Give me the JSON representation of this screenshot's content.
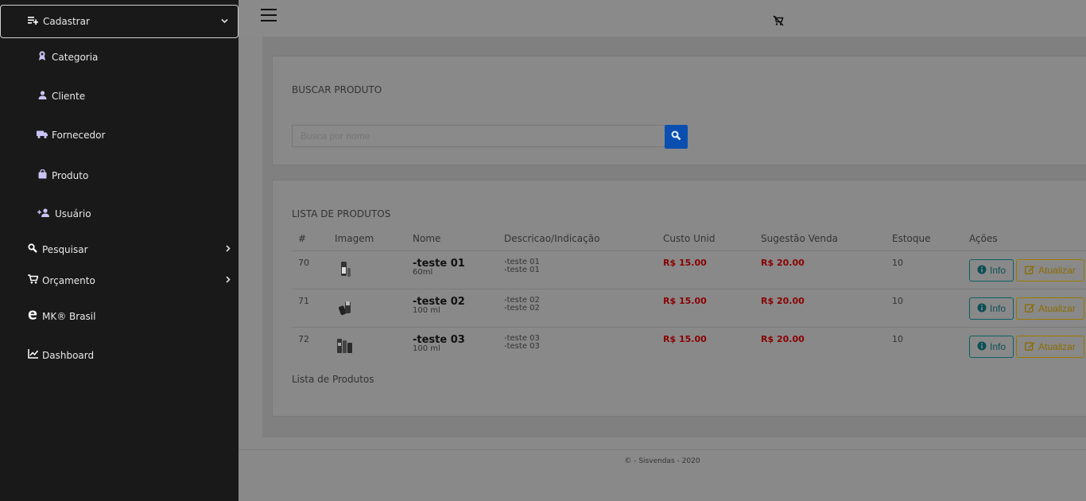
{
  "sidebar": {
    "cadastrar": {
      "label": "Cadastrar",
      "icon": "playlist-add-icon"
    },
    "sub_items": [
      {
        "label": "Categoria",
        "icon": "award-icon"
      },
      {
        "label": "Cliente",
        "icon": "user-icon"
      },
      {
        "label": "Fornecedor",
        "icon": "truck-icon"
      },
      {
        "label": "Produto",
        "icon": "bag-icon"
      },
      {
        "label": "Usuário",
        "icon": "user-plus-icon"
      }
    ],
    "items": [
      {
        "label": "Pesquisar",
        "icon": "search-icon"
      },
      {
        "label": "Orçamento",
        "icon": "cart-icon"
      },
      {
        "label": "MK® Brasil",
        "icon": "edge-icon"
      },
      {
        "label": "Dashboard",
        "icon": "chart-line-icon"
      }
    ]
  },
  "search_card": {
    "title": "BUSCAR PRODUTO",
    "placeholder": "Busca por nome"
  },
  "list_card": {
    "title": "LISTA DE PRODUTOS",
    "columns": [
      "#",
      "Imagem",
      "Nome",
      "Descricao/Indicação",
      "Custo Unid",
      "Sugestão Venda",
      "Estoque",
      "Ações"
    ],
    "rows": [
      {
        "id": "70",
        "name": "-teste 01",
        "size": "60ml",
        "desc1": "-teste 01",
        "desc2": "-teste 01",
        "cost": "R$ 15.00",
        "price": "R$ 20.00",
        "stock": "10"
      },
      {
        "id": "71",
        "name": "-teste 02",
        "size": "100 ml",
        "desc1": "-teste 02",
        "desc2": "-teste 02",
        "cost": "R$ 15.00",
        "price": "R$ 20.00",
        "stock": "10"
      },
      {
        "id": "72",
        "name": "-teste 03",
        "size": "100 ml",
        "desc1": "-teste 03",
        "desc2": "-teste 03",
        "cost": "R$ 15.00",
        "price": "R$ 20.00",
        "stock": "10"
      }
    ],
    "info_label": "Info",
    "update_label": "Atualizar",
    "caption": "Lista de Produtos"
  },
  "footer": {
    "text": "© - Sisvendas - 2020"
  },
  "colors": {
    "sidebar": "#191919",
    "price": "#8a0000",
    "search_button": "#0a4fb0"
  }
}
